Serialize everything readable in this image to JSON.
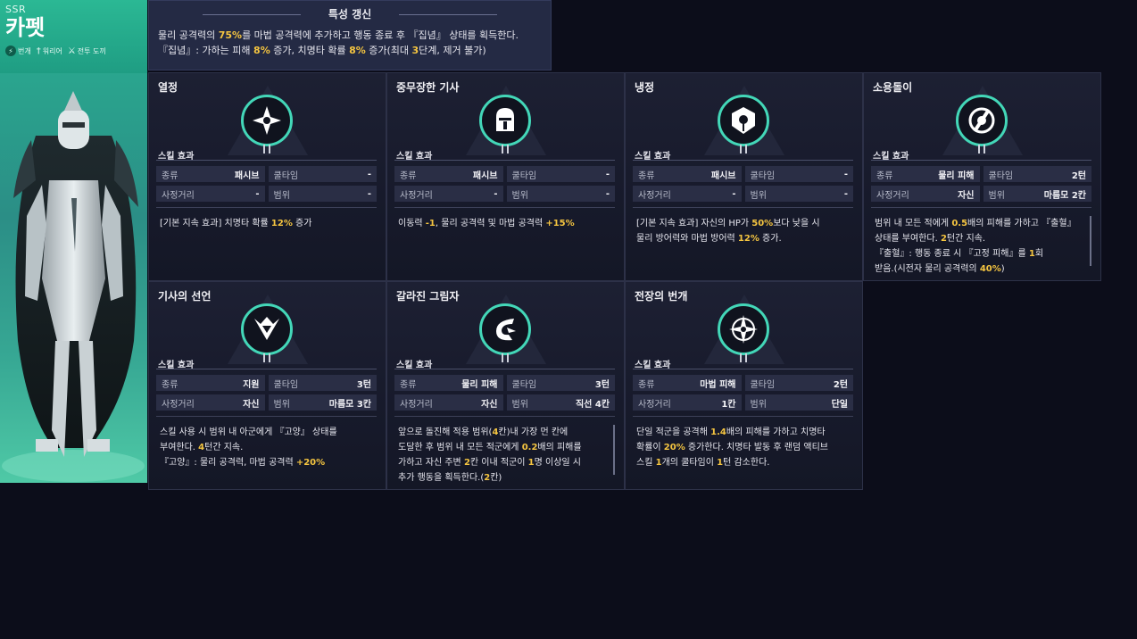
{
  "character": {
    "rarity": "SSR",
    "name": "카펫",
    "traits": [
      {
        "icon": "lightning-icon",
        "label": "번개"
      },
      {
        "icon": "sword-icon",
        "label": "워리어"
      },
      {
        "icon": "slash-icon",
        "label": "전투 도끼"
      }
    ]
  },
  "banner": {
    "title": "특성 갱신",
    "line1": {
      "pre": "물리 공격력의 ",
      "hl1": "75%",
      "post": "를 마법 공격력에 추가하고 행동 종료 후 『집념』 상태를 획득한다."
    },
    "line2": {
      "p1": "『집념』: 가하는 피해 ",
      "hl1": "8%",
      "p2": " 증가, 치명타 확률 ",
      "hl2": "8%",
      "p3": " 증가(최대 ",
      "hl3": "3",
      "p4": "단계, 제거 불가)"
    }
  },
  "labels": {
    "effect": "스킬 효과",
    "type": "종류",
    "cooldown": "쿨타임",
    "range": "사정거리",
    "area": "범위"
  },
  "skills": [
    {
      "name": "열정",
      "icon": "shuriken-icon",
      "type": "패시브",
      "cooldown": "-",
      "range": "-",
      "area": "-",
      "desc": [
        [
          {
            "t": "[기본 지속 효과] 치명타 확률 "
          },
          {
            "t": "12%",
            "h": 1
          },
          {
            "t": " 증가"
          }
        ]
      ],
      "scroll": false
    },
    {
      "name": "중무장한 기사",
      "icon": "helmet-icon",
      "type": "패시브",
      "cooldown": "-",
      "range": "-",
      "area": "-",
      "desc": [
        [
          {
            "t": "이동력 "
          },
          {
            "t": "-1",
            "h": 1
          },
          {
            "t": ", 물리 공격력 및 마법 공격력 "
          },
          {
            "t": "+15%",
            "h": 1
          }
        ]
      ],
      "scroll": false
    },
    {
      "name": "냉정",
      "icon": "shield-icon",
      "type": "패시브",
      "cooldown": "-",
      "range": "-",
      "area": "-",
      "desc": [
        [
          {
            "t": "[기본 지속 효과] 자신의 HP가 "
          },
          {
            "t": "50%",
            "h": 1
          },
          {
            "t": "보다 낮을 시"
          }
        ],
        [
          {
            "t": "물리 방어력와 마법 방어력 "
          },
          {
            "t": "12%",
            "h": 1
          },
          {
            "t": " 증가."
          }
        ]
      ],
      "scroll": false
    },
    {
      "name": "소용돌이",
      "icon": "whirl-icon",
      "type": "물리 피해",
      "cooldown": "2턴",
      "range": "자신",
      "area": "마름모 2칸",
      "desc": [
        [
          {
            "t": "범위 내 모든 적에게 "
          },
          {
            "t": "0.5",
            "h": 1
          },
          {
            "t": "배의 피해를 가하고 『출혈』"
          }
        ],
        [
          {
            "t": "상태를 부여한다. "
          },
          {
            "t": "2",
            "h": 1
          },
          {
            "t": "턴간 지속."
          }
        ],
        [
          {
            "t": "『출혈』: 행동 종료 시 『고정 피해』를 "
          },
          {
            "t": "1",
            "h": 1
          },
          {
            "t": "회"
          }
        ],
        [
          {
            "t": "받음.(시전자 물리 공격력의 "
          },
          {
            "t": "40%",
            "h": 1
          },
          {
            "t": ")"
          }
        ]
      ],
      "scroll": true
    },
    {
      "name": "기사의 선언",
      "icon": "crest-icon",
      "type": "지원",
      "cooldown": "3턴",
      "range": "자신",
      "area": "마름모 3칸",
      "desc": [
        [
          {
            "t": "스킬 사용 시 범위 내 아군에게 『고양』 상태를"
          }
        ],
        [
          {
            "t": "부여한다. "
          },
          {
            "t": "4",
            "h": 1
          },
          {
            "t": "턴간 지속."
          }
        ],
        [
          {
            "t": "『고양』: 물리 공격력, 마법 공격력 "
          },
          {
            "t": "+20%",
            "h": 1
          }
        ]
      ],
      "scroll": false
    },
    {
      "name": "갈라진 그림자",
      "icon": "claw-icon",
      "type": "물리 피해",
      "cooldown": "3턴",
      "range": "자신",
      "area": "직선 4칸",
      "desc": [
        [
          {
            "t": "앞으로 돌진해 적용 범위("
          },
          {
            "t": "4",
            "h": 1
          },
          {
            "t": "칸)내 가장 먼 칸에"
          }
        ],
        [
          {
            "t": "도달한 후 범위 내 모든 적군에게 "
          },
          {
            "t": "0.2",
            "h": 1
          },
          {
            "t": "배의 피해를"
          }
        ],
        [
          {
            "t": "가하고 자신 주변 "
          },
          {
            "t": "2",
            "h": 1
          },
          {
            "t": "칸 이내 적군이 "
          },
          {
            "t": "1",
            "h": 1
          },
          {
            "t": "명 이상일 시"
          }
        ],
        [
          {
            "t": "추가 행동을 획득한다.("
          },
          {
            "t": "2",
            "h": 1
          },
          {
            "t": "칸)"
          }
        ]
      ],
      "scroll": true
    },
    {
      "name": "전장의 번개",
      "icon": "compass-icon",
      "type": "마법 피해",
      "cooldown": "2턴",
      "range": "1칸",
      "area": "단일",
      "desc": [
        [
          {
            "t": "단일 적군을 공격해 "
          },
          {
            "t": "1.4",
            "h": 1
          },
          {
            "t": "배의 피해를 가하고 치명타"
          }
        ],
        [
          {
            "t": "확률이 "
          },
          {
            "t": "20%",
            "h": 1
          },
          {
            "t": " 증가한다. 치명타 발동 후 랜덤 액티브"
          }
        ],
        [
          {
            "t": "스킬 "
          },
          {
            "t": "1",
            "h": 1
          },
          {
            "t": "개의 쿨타임이 "
          },
          {
            "t": "1",
            "h": 1
          },
          {
            "t": "턴 감소한다."
          }
        ]
      ],
      "scroll": false
    }
  ],
  "colors": {
    "accent": "#43d7b8",
    "highlight": "#f5c540",
    "panel": "#1a1d2f"
  }
}
